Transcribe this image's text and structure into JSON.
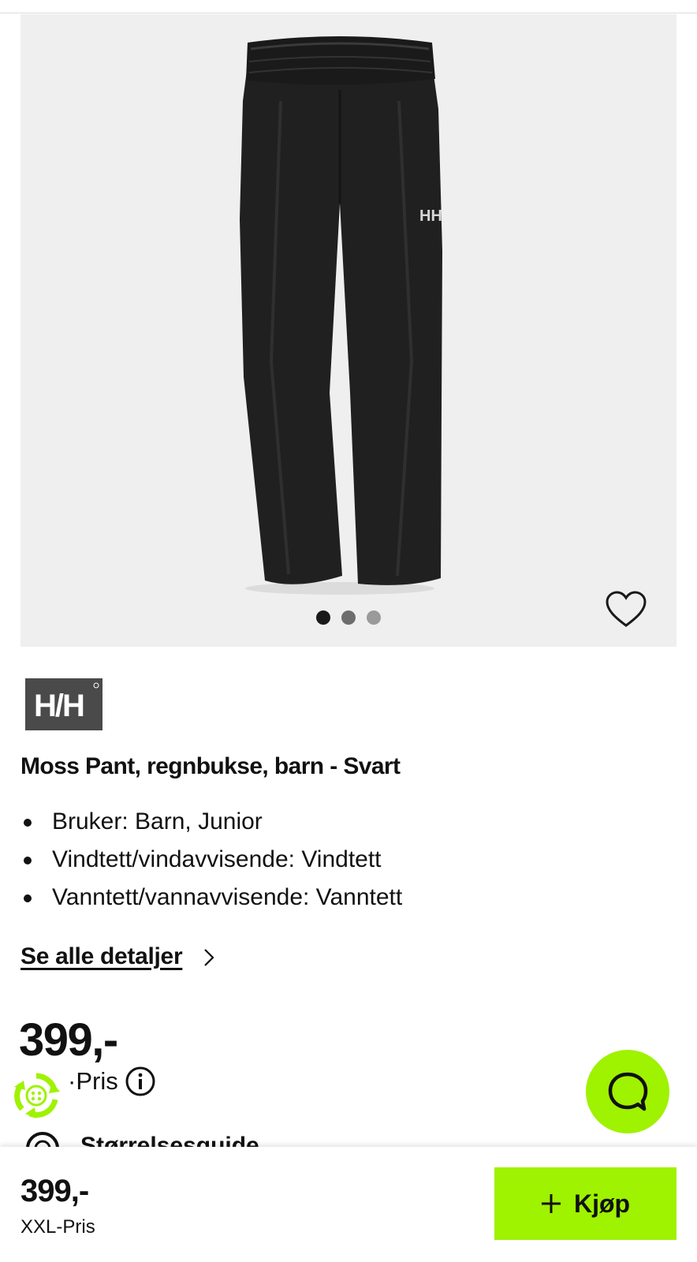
{
  "gallery": {
    "image_alt": "Moss Pant, regnbukse, barn - Svart",
    "slide_count": 3,
    "active_slide": 1,
    "favorite_icon": "heart-outline-icon"
  },
  "brand": {
    "logo_text": "H/H"
  },
  "product": {
    "title": "Moss Pant, regnbukse, barn - Svart",
    "features": [
      "Bruker: Barn, Junior",
      "Vindtett/vindavvisende: Vindtett",
      "Vanntett/vannavvisende: Vanntett"
    ],
    "details_link": "Se alle detaljer"
  },
  "price": {
    "value": "399,-",
    "label": "·Pris",
    "recycle_icon": "recycle-icon",
    "info_icon": "info-icon"
  },
  "size_guide": {
    "label": "Størrelsesguide",
    "icon": "size-guide-icon"
  },
  "chat": {
    "icon": "chat-bubble-icon"
  },
  "bottom_bar": {
    "price": "399,-",
    "price_label": "XXL-Pris",
    "buy_label": "Kjøp",
    "buy_icon": "plus-icon"
  },
  "colors": {
    "accent": "#9ff200",
    "text": "#111111",
    "gallery_bg": "#efefef"
  }
}
